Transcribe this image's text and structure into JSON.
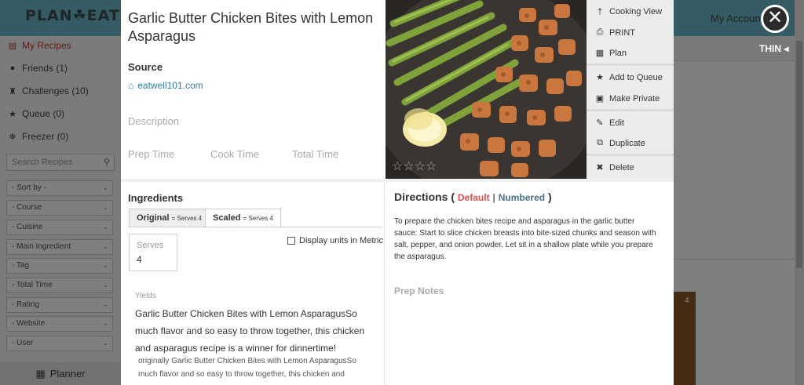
{
  "app": {
    "logo": "PLAN☘EAT",
    "account_label": "My Account",
    "thin_label": "THIN ◂",
    "planner_label": "Planner",
    "thumb_count": "4"
  },
  "sidebar": {
    "items": [
      {
        "label": "My Recipes",
        "icon": "book-icon"
      },
      {
        "label": "Friends (1)",
        "icon": "user-icon"
      },
      {
        "label": "Challenges (10)",
        "icon": "trophy-icon"
      },
      {
        "label": "Queue (0)",
        "icon": "star-icon"
      },
      {
        "label": "Freezer (0)",
        "icon": "snowflake-icon"
      }
    ],
    "search_placeholder": "Search Recipes",
    "filters": [
      "- Sort by -",
      "- Course",
      "- Cuisine",
      "- Main Ingredient",
      "- Tag",
      "- Total Time",
      "- Rating",
      "- Website",
      "- User"
    ]
  },
  "recipe": {
    "title": "Garlic Butter Chicken Bites with Lemon Asparagus",
    "source_label": "Source",
    "source_url": "eatwell101.com",
    "description_label": "Description",
    "prep_time_label": "Prep Time",
    "cook_time_label": "Cook Time",
    "total_time_label": "Total Time",
    "stars": "☆☆☆☆"
  },
  "actions": [
    {
      "label": "Cooking View",
      "icon": "utensils-icon",
      "glyph": "†"
    },
    {
      "label": "PRINT",
      "icon": "print-icon",
      "glyph": "⎙"
    },
    {
      "label": "Plan",
      "icon": "calendar-icon",
      "glyph": "▦"
    },
    {
      "label": "Add to Queue",
      "icon": "star-icon",
      "glyph": "★"
    },
    {
      "label": "Make Private",
      "icon": "lock-icon",
      "glyph": "▣"
    },
    {
      "label": "Edit",
      "icon": "pencil-icon",
      "glyph": "✎"
    },
    {
      "label": "Duplicate",
      "icon": "copy-icon",
      "glyph": "⧉"
    },
    {
      "label": "Delete",
      "icon": "trash-icon",
      "glyph": "✖"
    }
  ],
  "ingredients": {
    "heading": "Ingredients",
    "tab_original": "Original",
    "tab_original_serves": "= Serves 4",
    "tab_scaled": "Scaled",
    "tab_scaled_serves": "= Serves 4",
    "metric_label": "Display units in Metric",
    "serves_label": "Serves",
    "serves_value": "4",
    "yields_label": "Yields",
    "yield_text": "Garlic Butter Chicken Bites with Lemon AsparagusSo much flavor and so easy to throw together, this chicken and asparagus recipe is a winner for dinnertime!",
    "yield_small": "originally Garlic Butter Chicken Bites with Lemon AsparagusSo much flavor and so easy to throw together, this chicken and"
  },
  "directions": {
    "heading": "Directions",
    "paren_open": "(",
    "default_label": "Default",
    "sep": "|",
    "numbered_label": "Numbered",
    "paren_close": ")",
    "text": "To prepare the chicken bites recipe and asparagus in the garlic butter sauce: Start to slice chicken breasts into bite-sized chunks and season with salt, pepper, and onion powder. Let sit in a shallow plate while you prepare the asparagus.",
    "prep_notes_label": "Prep Notes"
  },
  "close_glyph": "✕",
  "colors": {
    "accent_red": "#d9534f",
    "link_blue": "#2a7fa8",
    "topbar": "#6bb6c9"
  }
}
